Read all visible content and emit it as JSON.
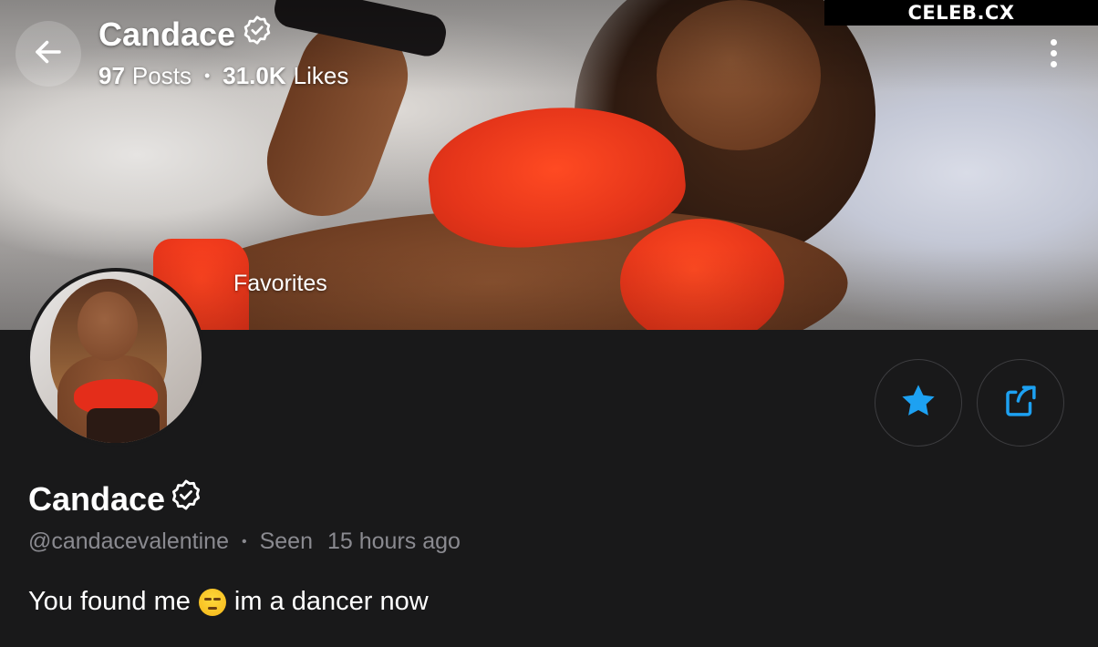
{
  "watermark": "CELEB.CX",
  "header": {
    "title": "Candace",
    "posts": "97",
    "posts_label": "Posts",
    "likes": "31.0K",
    "likes_label": "Likes"
  },
  "cover": {
    "favorites_label": "Favorites"
  },
  "profile": {
    "name": "Candace",
    "handle": "@candacevalentine",
    "seen_label": "Seen",
    "seen_time": "15 hours ago",
    "bio_before": "You found me",
    "bio_emoji": "unamused-face-emoji",
    "bio_after": "im a dancer now"
  },
  "icons": {
    "back": "arrow-left-icon",
    "verified": "verified-badge-icon",
    "menu": "more-vertical-icon",
    "favorite": "star-icon",
    "share": "share-icon"
  },
  "colors": {
    "background": "#19191a",
    "accent": "#1da1f2",
    "muted_text": "#8a8a90"
  }
}
